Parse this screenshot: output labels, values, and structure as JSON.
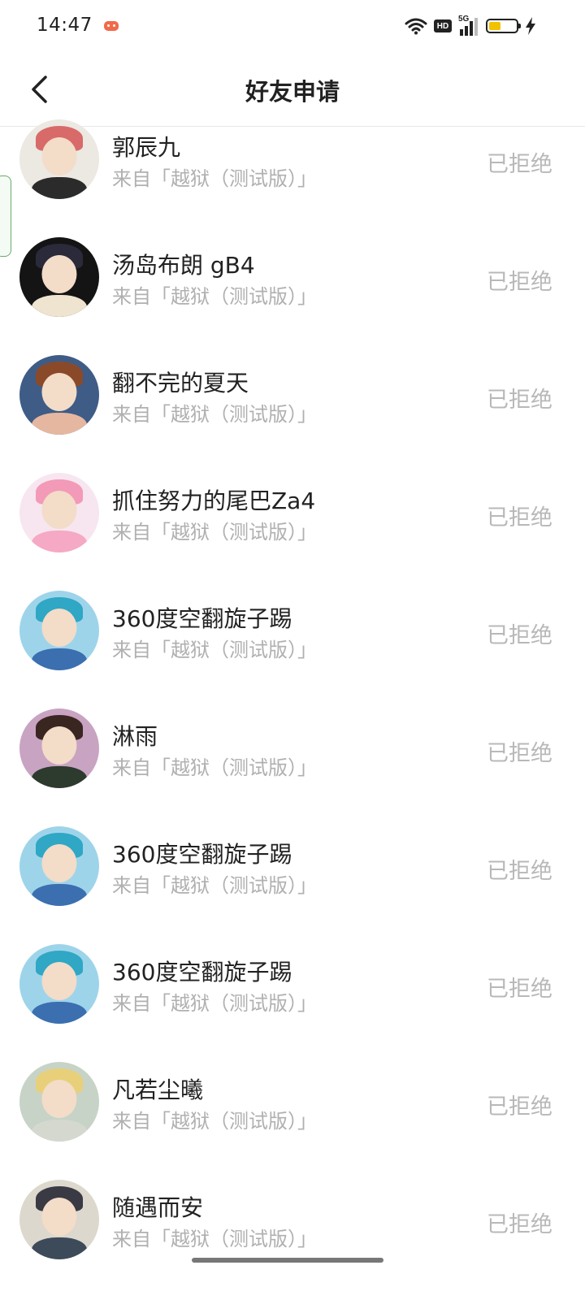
{
  "status_bar": {
    "time": "14:47",
    "icons": [
      "game-icon",
      "wifi-icon",
      "hd-icon",
      "signal-5g-icon",
      "battery-icon",
      "charging-bolt-icon"
    ],
    "hd_label": "HD",
    "network_label": "5G",
    "battery_color": "#f2c200"
  },
  "header": {
    "title": "好友申请",
    "back_icon": "chevron-left-icon"
  },
  "requests": [
    {
      "name": "郭辰九",
      "source": "来自「越狱（测试版）」",
      "status": "已拒绝",
      "avatar_bg": "#ece8e2",
      "hair": "#d86a6a",
      "body": "#2b2b2b"
    },
    {
      "name": "汤岛布朗 gB4",
      "source": "来自「越狱（测试版）」",
      "status": "已拒绝",
      "avatar_bg": "#141414",
      "hair": "#2a2a3a",
      "body": "#efe4cf"
    },
    {
      "name": "翻不完的夏天",
      "source": "来自「越狱（测试版）」",
      "status": "已拒绝",
      "avatar_bg": "#3e5c86",
      "hair": "#8a4a2a",
      "body": "#e6b7a0"
    },
    {
      "name": "抓住努力的尾巴Za4",
      "source": "来自「越狱（测试版）」",
      "status": "已拒绝",
      "avatar_bg": "#f7e6ef",
      "hair": "#f29ab8",
      "body": "#f5a9c4"
    },
    {
      "name": "360度空翻旋子踢",
      "source": "来自「越狱（测试版）」",
      "status": "已拒绝",
      "avatar_bg": "#9ed4ea",
      "hair": "#2fa7c5",
      "body": "#3b6fb0"
    },
    {
      "name": "淋雨",
      "source": "来自「越狱（测试版）」",
      "status": "已拒绝",
      "avatar_bg": "#c9a3c2",
      "hair": "#3a2620",
      "body": "#2d3a2e"
    },
    {
      "name": "360度空翻旋子踢",
      "source": "来自「越狱（测试版）」",
      "status": "已拒绝",
      "avatar_bg": "#9ed4ea",
      "hair": "#2fa7c5",
      "body": "#3b6fb0"
    },
    {
      "name": "360度空翻旋子踢",
      "source": "来自「越狱（测试版）」",
      "status": "已拒绝",
      "avatar_bg": "#9ed4ea",
      "hair": "#2fa7c5",
      "body": "#3b6fb0"
    },
    {
      "name": "凡若尘曦",
      "source": "来自「越狱（测试版）」",
      "status": "已拒绝",
      "avatar_bg": "#c7d3c7",
      "hair": "#e8d07a",
      "body": "#d5d8cf"
    },
    {
      "name": "随遇而安",
      "source": "来自「越狱（测试版）」",
      "status": "已拒绝",
      "avatar_bg": "#ddd8cd",
      "hair": "#3a3a44",
      "body": "#3c4a5a"
    }
  ]
}
